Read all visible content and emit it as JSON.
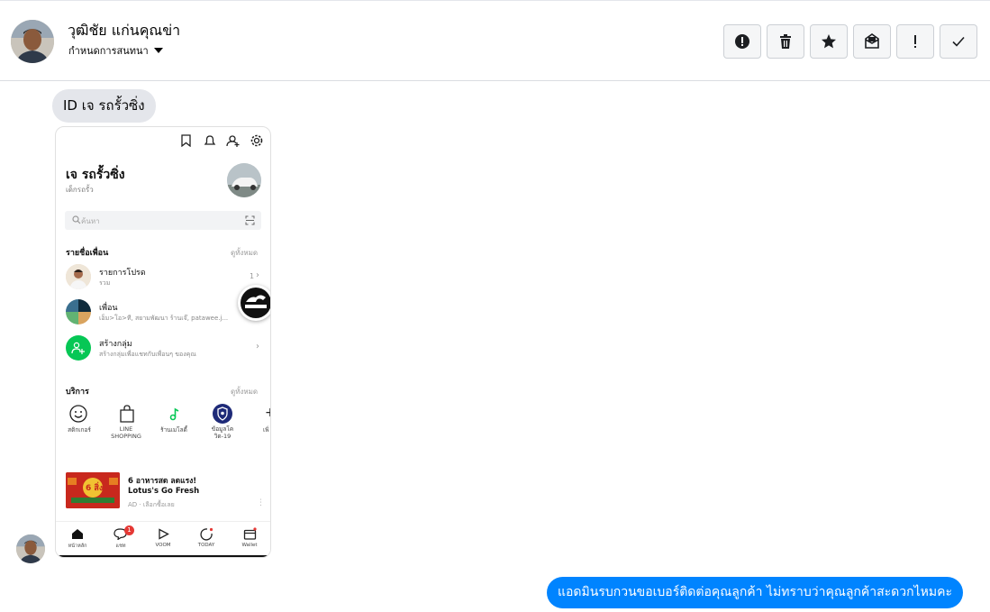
{
  "header": {
    "contact_name": "วุฒิชัย แก่นคุณข่า",
    "conversation_settings": "กำหนดการสนทนา",
    "actions": [
      {
        "icon": "alert-circle-icon",
        "name": "action-spam-button"
      },
      {
        "icon": "trash-icon",
        "name": "action-delete-button"
      },
      {
        "icon": "star-icon",
        "name": "action-star-button"
      },
      {
        "icon": "mail-unread-icon",
        "name": "action-unread-button"
      },
      {
        "icon": "exclamation-icon",
        "name": "action-followup-button"
      },
      {
        "icon": "check-icon",
        "name": "action-done-button"
      }
    ]
  },
  "messages": {
    "incoming_text": "ID เจ รถรั้วซิ่ง",
    "outgoing_text": "แอดมินรบกวนขอเบอร์ติดต่อคุณลูกค้า ไม่ทราบว่าคุณลูกค้าสะดวกไหมคะ"
  },
  "screenshot": {
    "profile_name": "เจ รถรั้วซิ่ง",
    "profile_status": "เด็กรถรั้ว",
    "search_placeholder": "ค้นหา",
    "friends_section": "รายชื่อเพื่อน",
    "see_all": "ดูทั้งหมด",
    "friends": [
      {
        "title": "รายการโปรด",
        "subtitle": "รวม",
        "count": "1"
      },
      {
        "title": "เพื่อน",
        "subtitle": "เอ็ม>โอ>ที, สยามพัฒนา ร้านเจ๊, patawee.j..."
      },
      {
        "title": "สร้างกลุ่ม",
        "subtitle": "สร้างกลุ่มเพื่อแชทกับเพื่อนๆ ของคุณ"
      }
    ],
    "services_section": "บริการ",
    "services": [
      {
        "label": "สติกเกอร์"
      },
      {
        "label": "LINE\nSHOPPING"
      },
      {
        "label": "ร้านเมโลดี้"
      },
      {
        "label": "ข้อมูลโค\nวิด-19"
      },
      {
        "label": "เพิ่"
      }
    ],
    "ad": {
      "title": "6 อาหารสด ลดแรง!",
      "brand": "Lotus's Go Fresh",
      "sub": "AD · เลือกซื้อเลย",
      "image_text": "6 สิ่ง"
    },
    "tabs": [
      {
        "label": "หน้าหลัก"
      },
      {
        "label": "แชท",
        "badge": "1"
      },
      {
        "label": "VOOM"
      },
      {
        "label": "TODAY"
      },
      {
        "label": "Wallet"
      }
    ],
    "overlay_logo_text": "CAR REPAIR"
  },
  "colors": {
    "outgoing_bubble": "#0084ff",
    "incoming_bubble": "#e4e6eb",
    "line_green": "#06c755",
    "badge_red": "#e53935"
  }
}
